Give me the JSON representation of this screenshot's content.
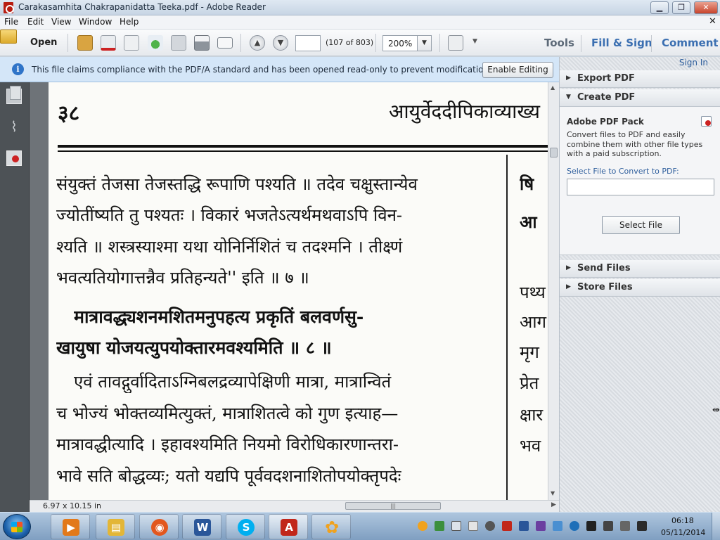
{
  "window": {
    "title": "Carakasamhita Chakrapanidatta Teeka.pdf - Adobe Reader",
    "min_glyph": "▁",
    "max_glyph": "❐",
    "close_glyph": "✕"
  },
  "menu": {
    "items": [
      "File",
      "Edit",
      "View",
      "Window",
      "Help"
    ],
    "doc_close_glyph": "✕"
  },
  "toolbar": {
    "open_label": "Open",
    "page_input": "",
    "page_count": "(107 of 803)",
    "zoom": "200%",
    "zoom_arrow": "▼",
    "prev_glyph": "▲",
    "next_glyph": "▼",
    "tabs": [
      "Tools",
      "Fill & Sign",
      "Comment"
    ]
  },
  "infobar": {
    "icon_glyph": "i",
    "message": "This file claims compliance with the PDF/A standard and has been opened read-only to prevent modification.",
    "button": "Enable Editing"
  },
  "document": {
    "page_number": "३८",
    "running_head": "आयुर्वेददीपिकाव्याख्य",
    "lines": [
      "संयुक्तं तेजसा तेजस्तद्धि रूपाणि पश्यति ॥ तदेव चक्षुस्तान्येव",
      "ज्योतींष्यति तु पश्यतः । विकारं भजतेऽत्यर्थमथवाऽपि विन-",
      "श्यति ॥ शस्त्रस्याश्मा यथा योनिर्निशितं च तदश्मनि । तीक्ष्णं",
      "भवत्यतियोगात्तन्नैव प्रतिहन्यते'' इति ॥ ७ ॥",
      "मात्रावद्ध्यशनमशितमनुपहत्य प्रकृतिं बलवर्णसु-",
      "खायुषा योजयत्युपयोक्तारमवश्यमिति ॥ ८ ॥",
      "एवं तावद्गुर्वादिताऽग्निबलद्रव्यापेक्षिणी मात्रा, मात्रान्वितं",
      "च भोज्यं भोक्तव्यमित्युक्तं, मात्राशितत्वे को गुण इत्याह—",
      "मात्रावद्धीत्यादि । इहावश्यमिति नियमो विरोधिकारणान्तरा-",
      "भावे सति बोद्धव्यः; यतो यद्यपि पूर्ववदशनाशितोपयोक्तृपदेः"
    ],
    "right_column": [
      "षि",
      "आ",
      "पथ्य",
      "आग",
      "मृग",
      "प्रेत",
      "क्षार",
      "भव"
    ]
  },
  "statusbar": {
    "page_size": "6.97 x 10.15 in",
    "hscroll_grip": "|||",
    "hscroll_right_glyph": "▶"
  },
  "rightpane": {
    "sign_in": "Sign In",
    "sections": [
      {
        "label": "Export PDF",
        "arrow": "▶"
      },
      {
        "label": "Create PDF",
        "arrow": "▼"
      },
      {
        "label": "Send Files",
        "arrow": "▶"
      },
      {
        "label": "Store Files",
        "arrow": "▶"
      }
    ],
    "create": {
      "pack_title": "Adobe PDF Pack",
      "description": "Convert files to PDF and easily combine them with other file types with a paid subscription.",
      "select_label": "Select File to Convert to PDF:",
      "select_button": "Select File"
    }
  },
  "taskbar": {
    "apps": [
      {
        "name": "windows-media-player",
        "glyph": "▶",
        "color": "#e2791a"
      },
      {
        "name": "file-explorer",
        "glyph": "▤",
        "color": "#e3b637"
      },
      {
        "name": "firefox",
        "glyph": "◉",
        "color": "#e2571e"
      },
      {
        "name": "word",
        "glyph": "W",
        "color": "#2a5699"
      },
      {
        "name": "skype",
        "glyph": "S",
        "color": "#00aff0"
      },
      {
        "name": "adobe-reader",
        "glyph": "A",
        "color": "#c1271a"
      },
      {
        "name": "flower-app",
        "glyph": "✿",
        "color": "#f0a21e"
      }
    ],
    "clock_time": "06:18",
    "clock_date": "05/11/2014"
  },
  "colors": {
    "accent": "#3b6fb1",
    "info_bar": "#d4e6f8",
    "close_red": "#c8442c"
  }
}
